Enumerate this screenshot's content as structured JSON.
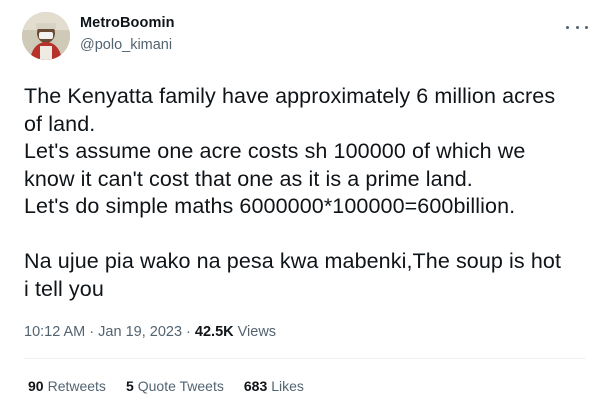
{
  "author": {
    "display_name": "MetroBoomin",
    "handle": "@polo_kimani"
  },
  "tweet": {
    "text": "The Kenyatta family have approximately 6 million acres\nof land.\nLet's assume one acre costs sh 100000 of which we\nknow it can't cost that one as it is a prime land.\nLet's do simple maths 6000000*100000=600billion.\n\nNa ujue pia wako na pesa kwa mabenki,The soup is hot\ni tell you"
  },
  "meta": {
    "time": "10:12 AM",
    "separator": " · ",
    "date": "Jan 19, 2023",
    "views_count": "42.5K",
    "views_label": " Views"
  },
  "stats": {
    "retweets_count": "90",
    "retweets_label": "Retweets",
    "quotes_count": "5",
    "quotes_label": "Quote Tweets",
    "likes_count": "683",
    "likes_label": "Likes"
  },
  "icons": {
    "more": "more-horizontal-icon"
  },
  "colors": {
    "primary_text": "#0f1419",
    "secondary_text": "#536471",
    "divider": "#eff3f4"
  }
}
